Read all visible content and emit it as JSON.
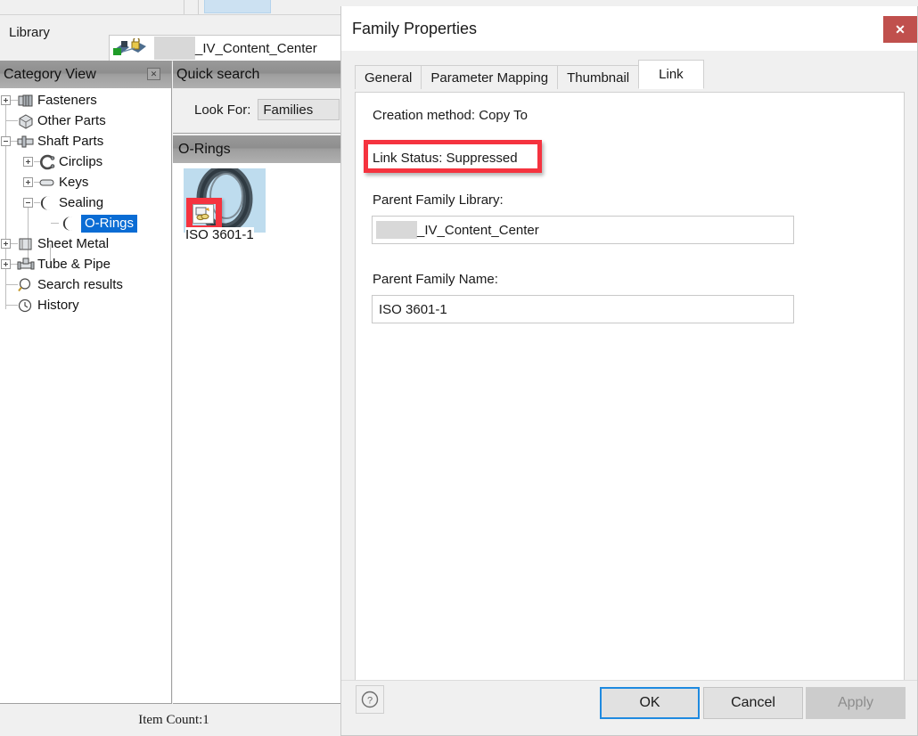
{
  "app": {
    "library_label": "Library",
    "library_value": "_IV_Content_Center",
    "library_icon": "content-center-library-icon",
    "status_text": "Item Count:1"
  },
  "category_view": {
    "title": "Category View",
    "close_icon": "close-icon",
    "tree": [
      {
        "label": "Fasteners",
        "icon": "fasteners-icon",
        "expander": "plus",
        "depth": 0
      },
      {
        "label": "Other Parts",
        "icon": "other-parts-icon",
        "expander": "none",
        "depth": 0
      },
      {
        "label": "Shaft Parts",
        "icon": "shaft-parts-icon",
        "expander": "minus",
        "depth": 0
      },
      {
        "label": "Circlips",
        "icon": "circlips-icon",
        "expander": "plus",
        "depth": 1
      },
      {
        "label": "Keys",
        "icon": "keys-icon",
        "expander": "plus",
        "depth": 1
      },
      {
        "label": "Sealing",
        "icon": "sealing-icon",
        "expander": "minus",
        "depth": 1
      },
      {
        "label": "O-Rings",
        "icon": "o-rings-icon",
        "expander": "none",
        "depth": 2,
        "selected": true
      },
      {
        "label": "Sheet Metal",
        "icon": "sheet-metal-icon",
        "expander": "plus",
        "depth": 0
      },
      {
        "label": "Tube & Pipe",
        "icon": "tube-and-pipe-icon",
        "expander": "plus",
        "depth": 0
      },
      {
        "label": "Search results",
        "icon": "search-results-icon",
        "expander": "none",
        "depth": 0
      },
      {
        "label": "History",
        "icon": "history-icon",
        "expander": "none",
        "depth": 0
      }
    ]
  },
  "quick_search": {
    "title": "Quick search",
    "look_for_label": "Look For:",
    "look_for_value": "Families"
  },
  "results": {
    "title": "O-Rings",
    "items": [
      {
        "caption": "ISO 3601-1",
        "badge_icon": "suppressed-link-icon",
        "thumb_icon": "o-ring-thumbnail"
      }
    ]
  },
  "dialog": {
    "title": "Family Properties",
    "close_icon": "close-icon",
    "tabs": [
      {
        "label": "General",
        "active": false
      },
      {
        "label": "Parameter Mapping",
        "active": false
      },
      {
        "label": "Thumbnail",
        "active": false
      },
      {
        "label": "Link",
        "active": true
      }
    ],
    "link_tab": {
      "creation_method": "Creation method: Copy To",
      "link_status": "Link Status: Suppressed",
      "parent_family_library_label": "Parent Family Library:",
      "parent_family_library_value": "_IV_Content_Center",
      "parent_family_name_label": "Parent Family Name:",
      "parent_family_name_value": "ISO 3601-1"
    },
    "footer": {
      "help_icon": "help-icon",
      "ok_label": "OK",
      "cancel_label": "Cancel",
      "apply_label": "Apply"
    }
  },
  "colors": {
    "highlight_red": "#f5333f",
    "selection_blue": "#0a6cd4",
    "close_red": "#c0504d",
    "focus_blue": "#1f8ae0",
    "thumb_bg": "#bedcee"
  }
}
